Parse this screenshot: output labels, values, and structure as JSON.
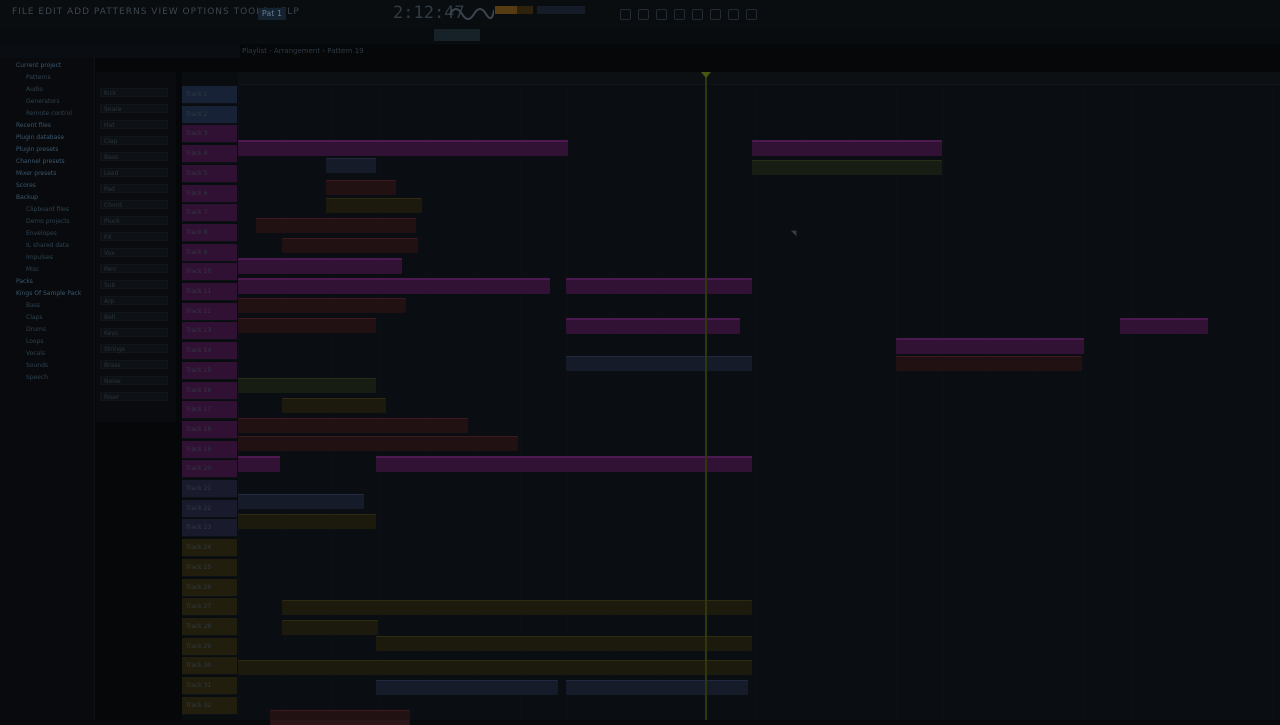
{
  "toolbar": {
    "pattern_label": "Pat 1",
    "time": "2:12:47",
    "menu": "FILE EDIT ADD PATTERNS VIEW OPTIONS TOOLS HELP"
  },
  "playlist": {
    "title": "Playlist - Arrangement › Pattern 19"
  },
  "browser": {
    "header": "Current project",
    "items": [
      {
        "label": "Current project",
        "folder": true
      },
      {
        "label": "Patterns"
      },
      {
        "label": "Audio"
      },
      {
        "label": "Generators"
      },
      {
        "label": "Remote control"
      },
      {
        "label": "Recent files",
        "folder": true
      },
      {
        "label": "Plugin database",
        "folder": true
      },
      {
        "label": "Plugin presets",
        "folder": true
      },
      {
        "label": "Channel presets",
        "folder": true
      },
      {
        "label": "Mixer presets",
        "folder": true
      },
      {
        "label": "Scores",
        "folder": true
      },
      {
        "label": "Backup",
        "folder": true
      },
      {
        "label": "Clipboard files"
      },
      {
        "label": "Demo projects"
      },
      {
        "label": "Envelopes"
      },
      {
        "label": "IL shared data"
      },
      {
        "label": "Impulses"
      },
      {
        "label": "Misc"
      },
      {
        "label": "Packs",
        "folder": true
      },
      {
        "label": "Kings Of Sample Pack",
        "folder": true
      },
      {
        "label": "Bass"
      },
      {
        "label": "Claps"
      },
      {
        "label": "Drums"
      },
      {
        "label": "Loops"
      },
      {
        "label": "Vocals"
      },
      {
        "label": "Sounds"
      },
      {
        "label": "Speech"
      }
    ]
  },
  "tracks": [
    "Track 1",
    "Track 2",
    "Track 3",
    "Track 4",
    "Track 5",
    "Track 6",
    "Track 7",
    "Track 8",
    "Track 9",
    "Track 10",
    "Track 11",
    "Track 12",
    "Track 13",
    "Track 14",
    "Track 15",
    "Track 16",
    "Track 17",
    "Track 18",
    "Track 19",
    "Track 20",
    "Track 21",
    "Track 22",
    "Track 23",
    "Track 24",
    "Track 25",
    "Track 26",
    "Track 27",
    "Track 28",
    "Track 29",
    "Track 30",
    "Track 31",
    "Track 32"
  ],
  "rack_channels": [
    "Kick",
    "Snare",
    "Hat",
    "Clap",
    "Bass",
    "Lead",
    "Pad",
    "Chord",
    "Pluck",
    "FX",
    "Vox",
    "Perc",
    "Sub",
    "Arp",
    "Bell",
    "Keys",
    "Strings",
    "Brass",
    "Noise",
    "Riser"
  ],
  "colors": {
    "clip_purple": "#3d1640",
    "clip_blue": "#1b2133",
    "clip_red": "#2a1518",
    "clip_yellow": "#22200f",
    "playhead": "#3a4410"
  }
}
